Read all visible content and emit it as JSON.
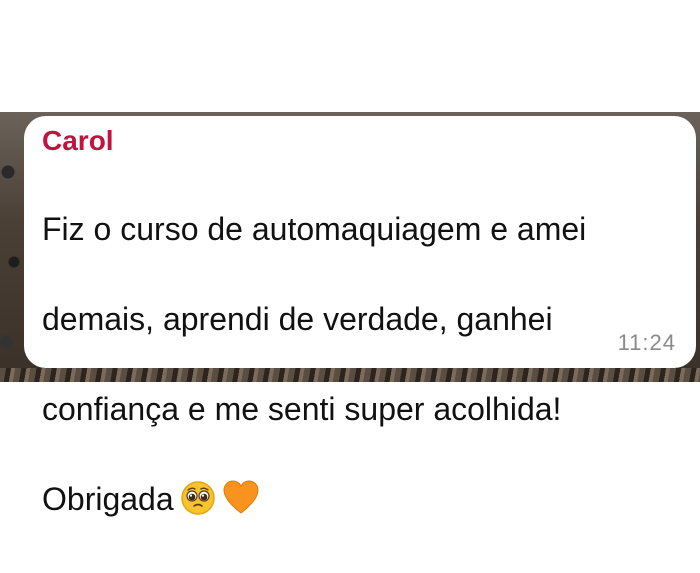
{
  "message": {
    "sender": "Carol",
    "lines": [
      "Fiz o curso de automaquiagem e amei",
      "demais, aprendi de verdade, ganhei",
      "confiança e me senti super acolhida!",
      "Obrigada"
    ],
    "emojis": [
      "pleading-face-icon",
      "orange-heart-icon"
    ],
    "time": "11:24"
  },
  "colors": {
    "sender": "#c4123f",
    "text": "#111111",
    "time": "#8a8a8a",
    "bubble": "#ffffff"
  }
}
